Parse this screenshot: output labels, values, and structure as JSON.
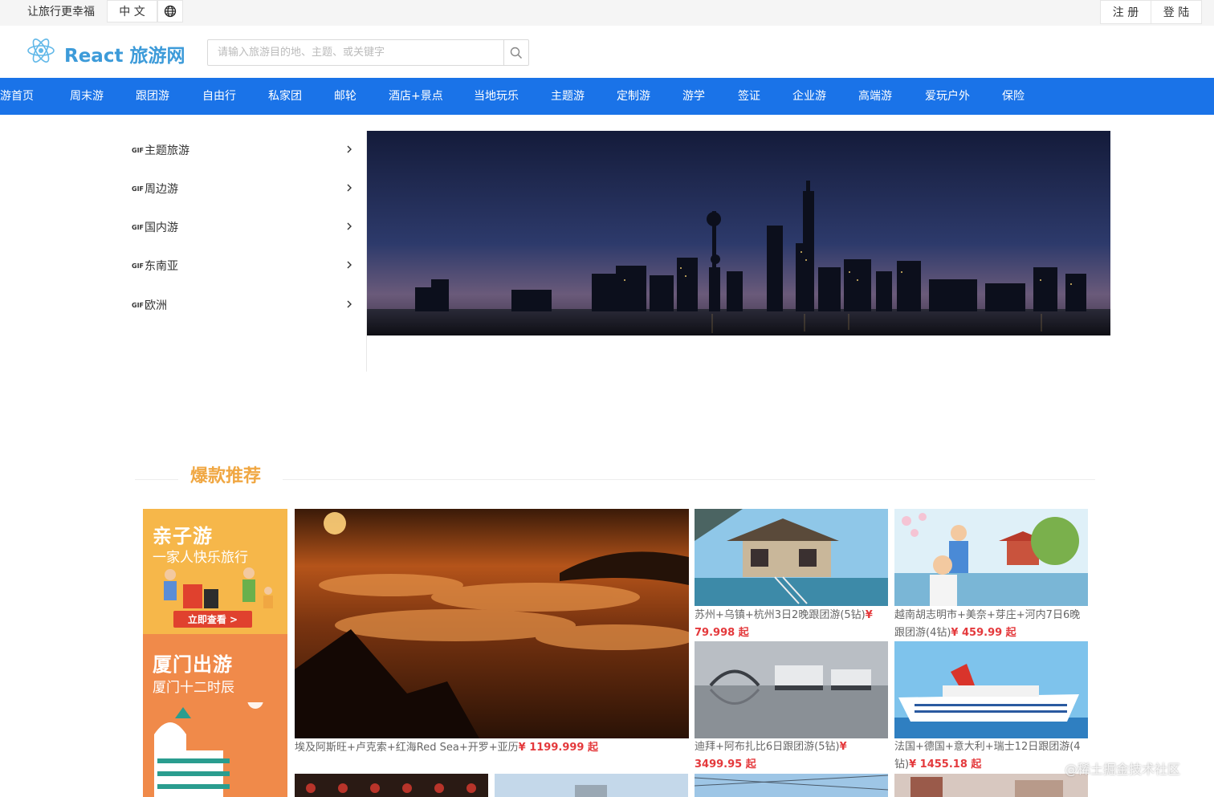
{
  "topbar": {
    "slogan": "让旅行更幸福",
    "language": "中 文",
    "register": "注 册",
    "login": "登 陆"
  },
  "header": {
    "brand": "React 旅游网",
    "search_placeholder": "请输入旅游目的地、主题、或关键字"
  },
  "nav": {
    "items": [
      "旅游首页",
      "周末游",
      "跟团游",
      "自由行",
      "私家团",
      "邮轮",
      "酒店+景点",
      "当地玩乐",
      "主题游",
      "定制游",
      "游学",
      "签证",
      "企业游",
      "高端游",
      "爱玩户外",
      "保险"
    ]
  },
  "side_menu": {
    "gif_label": "GIF",
    "items": [
      "主题旅游",
      "周边游",
      "国内游",
      "东南亚",
      "欧洲"
    ]
  },
  "section": {
    "title": "爆款推荐"
  },
  "promos": [
    {
      "title": "亲子游",
      "subtitle": "一家人快乐旅行",
      "cta": "立即查看 >"
    },
    {
      "title": "厦门出游",
      "subtitle": "厦门十二时辰"
    }
  ],
  "products": [
    {
      "title": "埃及阿斯旺+卢克索+红海Red Sea+开罗+亚历",
      "price": "¥ 1199.999 起"
    },
    {
      "title": "苏州+乌镇+杭州3日2晚跟团游(5钻)",
      "price": "¥ 79.998 起"
    },
    {
      "title": "越南胡志明市+美奈+芽庄+河内7日6晚跟团游(4钻)",
      "price": "¥ 459.99 起"
    },
    {
      "title": "迪拜+阿布扎比6日跟团游(5钻)",
      "price": "¥ 3499.95 起"
    },
    {
      "title": "法国+德国+意大利+瑞士12日跟团游(4钻)",
      "price": "¥ 1455.18 起"
    }
  ],
  "watermark": "@稀土掘金技术社区",
  "colors": {
    "nav": "#1a73e8",
    "brand": "#3d9bd9",
    "section_title": "#f0a742",
    "price": "#e4393c"
  }
}
